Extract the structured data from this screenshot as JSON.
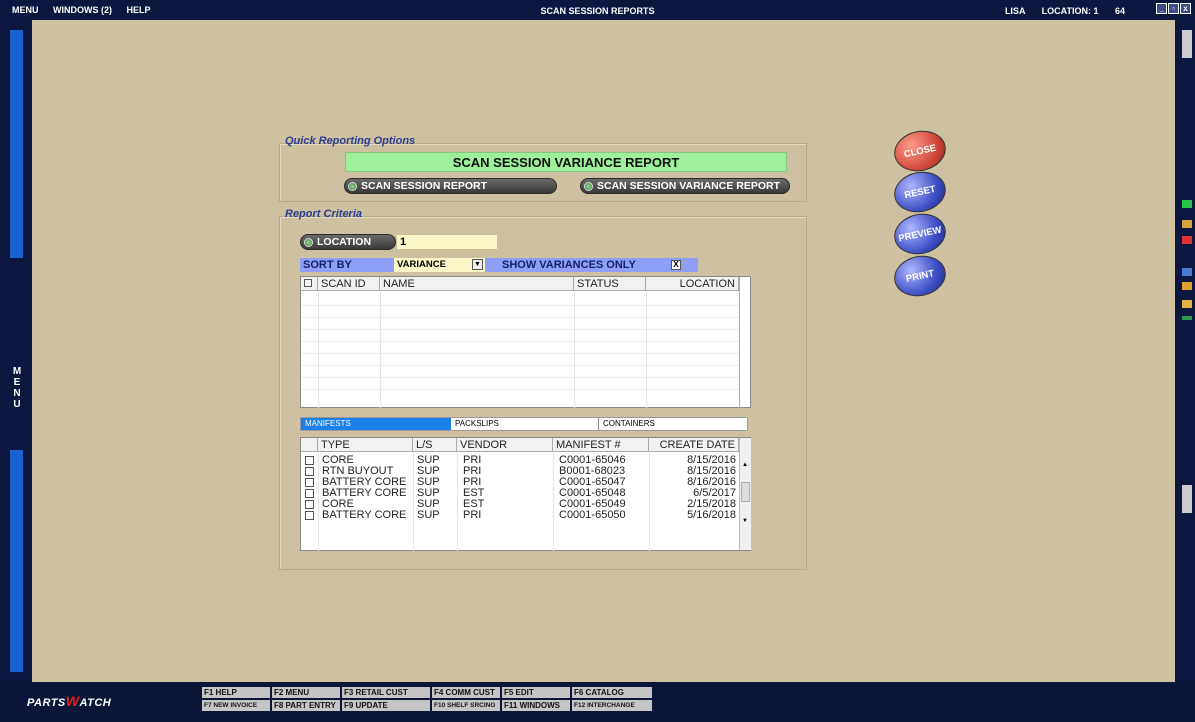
{
  "topbar": {
    "menu": "MENU",
    "windows": "WINDOWS (2)",
    "help": "HELP",
    "title": "SCAN SESSION REPORTS",
    "user": "LISA",
    "location": "LOCATION: 1",
    "num": "64"
  },
  "leftbar": {
    "letters": [
      "M",
      "E",
      "N",
      "U"
    ]
  },
  "quick": {
    "label": "Quick Reporting Options",
    "banner": "SCAN SESSION VARIANCE REPORT",
    "btn1": "SCAN SESSION REPORT",
    "btn2": "SCAN SESSION VARIANCE REPORT"
  },
  "criteria": {
    "label": "Report Criteria",
    "location_btn": "LOCATION",
    "location_value": "1",
    "sort_by": "SORT BY",
    "sort_value": "VARIANCE",
    "show_var": "SHOW VARIANCES ONLY",
    "show_var_checked": "X"
  },
  "scan_grid": {
    "headers": [
      "SCAN ID",
      "NAME",
      "STATUS",
      "LOCATION"
    ]
  },
  "tabs": [
    "MANIFESTS",
    "PACKSLIPS",
    "CONTAINERS"
  ],
  "manifest_grid": {
    "headers": [
      "TYPE",
      "L/S",
      "VENDOR",
      "MANIFEST #",
      "CREATE DATE"
    ],
    "rows": [
      {
        "type": "CORE",
        "ls": "SUP",
        "vendor": "PRI",
        "manifest": "C0001-65046",
        "date": "8/15/2016"
      },
      {
        "type": "RTN BUYOUT",
        "ls": "SUP",
        "vendor": "PRI",
        "manifest": "B0001-68023",
        "date": "8/15/2016"
      },
      {
        "type": "BATTERY CORE",
        "ls": "SUP",
        "vendor": "PRI",
        "manifest": "C0001-65047",
        "date": "8/16/2016"
      },
      {
        "type": "BATTERY CORE",
        "ls": "SUP",
        "vendor": "EST",
        "manifest": "C0001-65048",
        "date": "6/5/2017"
      },
      {
        "type": "CORE",
        "ls": "SUP",
        "vendor": "EST",
        "manifest": "C0001-65049",
        "date": "2/15/2018"
      },
      {
        "type": "BATTERY CORE",
        "ls": "SUP",
        "vendor": "PRI",
        "manifest": "C0001-65050",
        "date": "5/16/2018"
      }
    ]
  },
  "actions": {
    "close": "CLOSE",
    "reset": "RESET",
    "preview": "PREVIEW",
    "print": "PRINT"
  },
  "bottom": {
    "logo_a": "PARTS",
    "logo_b": "W",
    "logo_c": "ATCH",
    "fkeys": [
      "F1 HELP",
      "F2 MENU",
      "F3 RETAIL CUST",
      "F4 COMM CUST",
      "F5 EDIT",
      "F6 CATALOG",
      "F7 NEW INVOICE",
      "F8 PART ENTRY",
      "F9 UPDATE",
      "F10 SHELF SRCING",
      "F11 WINDOWS",
      "F12 INTERCHANGE"
    ]
  }
}
